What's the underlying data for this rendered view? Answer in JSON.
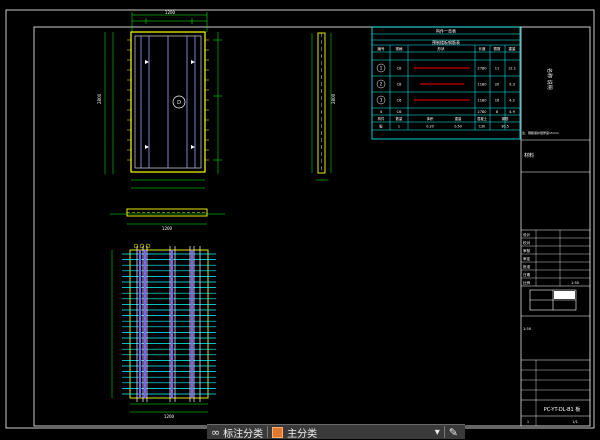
{
  "drawing": {
    "sheet_title": "PC-YT-DL-B1 板",
    "side_title": "名称 说明",
    "section_label": "材料",
    "sheet_code": "1:50",
    "footer_cell": "1/1",
    "plan_marker": "D",
    "dim_width_top": "1200",
    "dim_width_section": "1200",
    "dim_width_bottom": "1200",
    "dim_height_left": "2800",
    "dim_height_right": "2800",
    "table_title": "构件一览表",
    "table_subtitle": "预制楼板钢筋表",
    "table_header": [
      "编号",
      "规格",
      "形状",
      "长度",
      "根数",
      "重量"
    ],
    "table_rows": [
      [
        "1",
        "C8",
        "——",
        "2780",
        "11",
        "12.1"
      ],
      [
        "2",
        "C8",
        "——",
        "1180",
        "20",
        "9.3"
      ],
      [
        "3",
        "C6",
        "——",
        "1180",
        "16",
        "4.2"
      ],
      [
        "4",
        "C6",
        "——",
        "2780",
        "8",
        "4.9"
      ]
    ],
    "table_summary_header": [
      "构件",
      "数量",
      "体积",
      "重量",
      "混凝土",
      "钢筋"
    ],
    "table_summary_row": [
      "板",
      "1",
      "0.20",
      "0.50",
      "C30",
      "30.5"
    ],
    "table_note": "注：钢筋保护层厚度15mm",
    "title_rows": [
      "设计",
      "校对",
      "审核",
      "审定",
      "批准",
      "日期",
      "比例"
    ],
    "title_values": [
      "",
      "",
      "",
      "",
      "",
      "",
      "1:50"
    ],
    "page_num": "1"
  },
  "toolbar": {
    "item1_icon": "link-icon",
    "item1_label": "标注分类",
    "item2_label": "主分类",
    "item3_icon": "edit-icon",
    "chevron": "▾"
  },
  "colors": {
    "frame": "#ffffff",
    "cyan": "#00ffff",
    "yellow": "#ffff00",
    "magenta": "#ff00ff",
    "green": "#00ff00",
    "red": "#ff0000",
    "blue": "#4060ff"
  }
}
